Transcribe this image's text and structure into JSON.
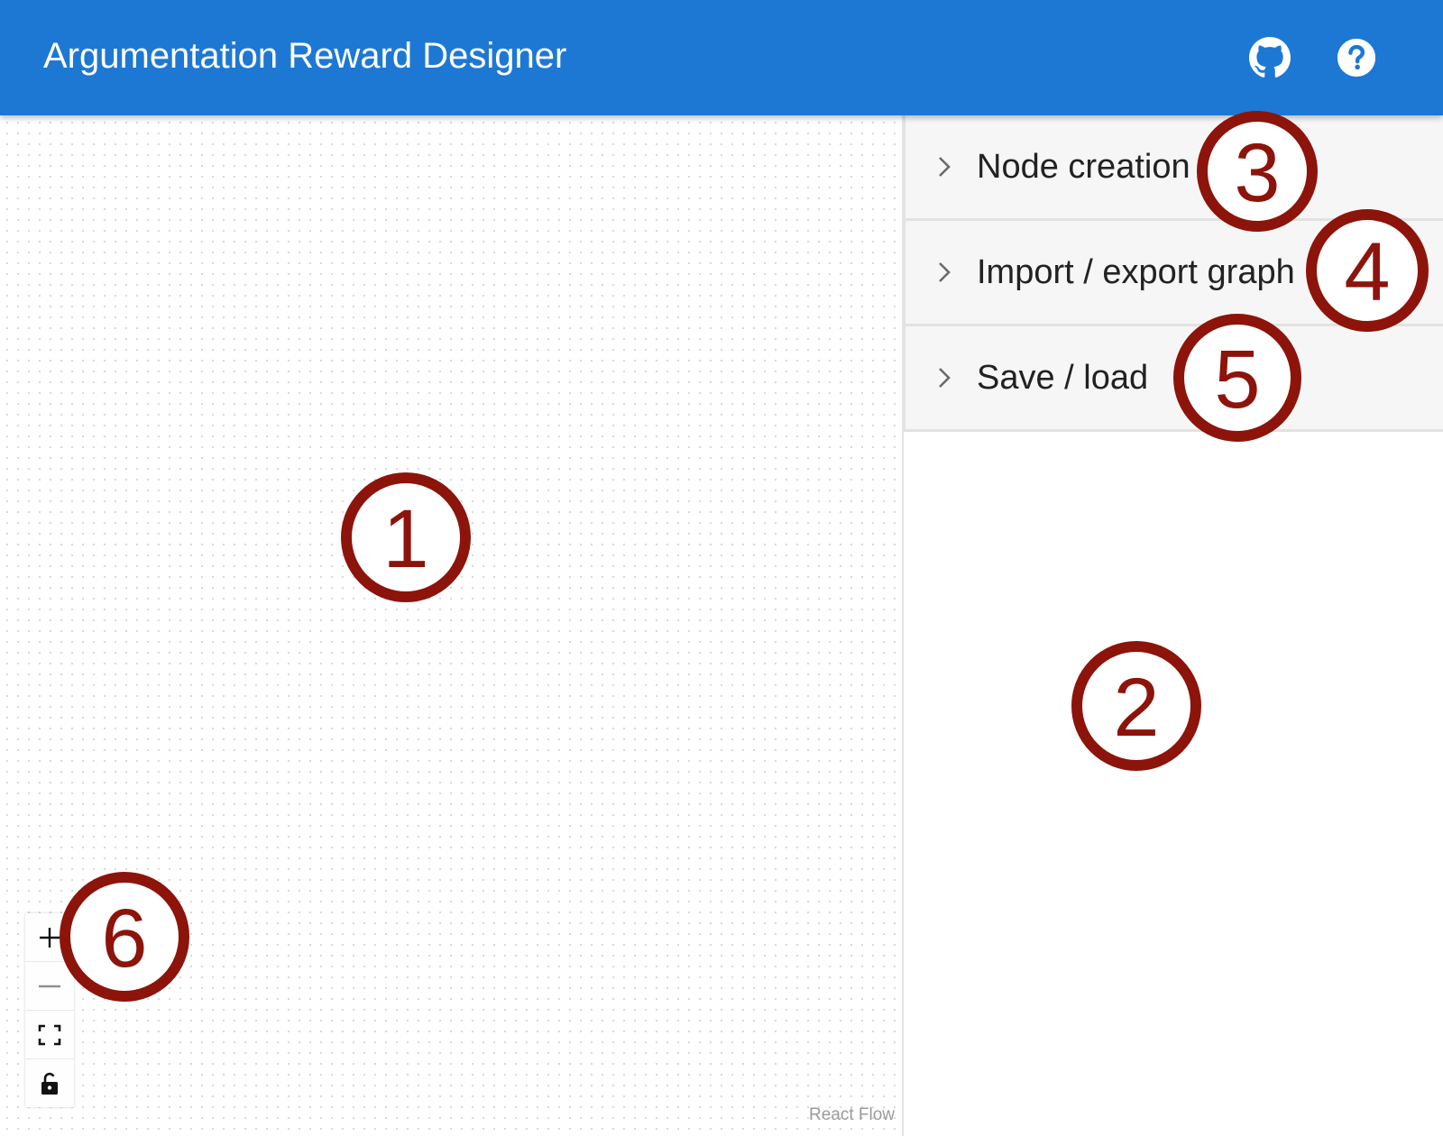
{
  "app": {
    "title": "Argumentation Reward Designer",
    "accent_color": "#1d78d4",
    "icons": {
      "github": "github-icon",
      "help": "help-icon"
    }
  },
  "panel": {
    "sections": [
      {
        "label": "Node creation",
        "icon": "chevron-right-icon",
        "expanded": false
      },
      {
        "label": "Import / export graph",
        "icon": "chevron-right-icon",
        "expanded": false
      },
      {
        "label": "Save / load",
        "icon": "chevron-right-icon",
        "expanded": false
      }
    ]
  },
  "canvas": {
    "attribution": "React Flow",
    "controls": [
      {
        "name": "zoom-in",
        "icon": "plus-icon"
      },
      {
        "name": "zoom-out",
        "icon": "minus-icon"
      },
      {
        "name": "fit-view",
        "icon": "fit-view-icon"
      },
      {
        "name": "toggle-interactivity",
        "icon": "lock-icon"
      }
    ]
  },
  "callouts": {
    "color": "#8c140b",
    "labels": [
      "1",
      "2",
      "3",
      "4",
      "5",
      "6"
    ]
  }
}
